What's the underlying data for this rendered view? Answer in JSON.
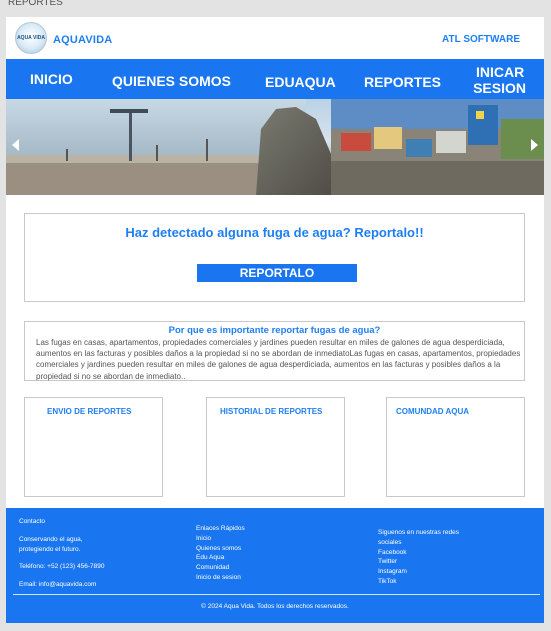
{
  "window": {
    "title": "REPORTES"
  },
  "header": {
    "logo_text": "AQUA VIDA",
    "brand": "AQUAVIDA",
    "company": "ATL SOFTWARE"
  },
  "nav": {
    "inicio": "INICIO",
    "quienes": "QUIENES SOMOS",
    "eduaqua": "EDUAQUA",
    "reportes": "REPORTES",
    "iniciar_1": "INICAR",
    "iniciar_2": "SESION"
  },
  "report": {
    "heading": "Haz detectado alguna fuga de agua? Reportalo!!",
    "button": "REPORTALO"
  },
  "why": {
    "title": "Por que es importante reportar fugas de agua?",
    "text": "Las fugas en casas, apartamentos, propiedades comerciales y jardines pueden resultar en miles de galones de agua desperdiciada, aumentos en las facturas y posibles daños a la propiedad si no se abordan de inmediatoLas fugas en casas, apartamentos, propiedades comerciales y jardines pueden resultar en miles de galones de agua desperdiciada, aumentos en las facturas y posibles daños a la propiedad si no se abordan de inmediato.."
  },
  "cards": [
    {
      "title": "ENVIO DE REPORTES"
    },
    {
      "title": "HISTORIAL DE REPORTES"
    },
    {
      "title": "COMUNDAD AQUA"
    }
  ],
  "footer": {
    "contact_title": "Contacto",
    "tagline_1": "Conservando el agua,",
    "tagline_2": "protegiendo el futuro.",
    "phone": "Teléfono: +52 (123) 456-7890",
    "email": "Email: info@aquavida.com",
    "quick_links": [
      "Enlaces Rápidos",
      "Inicio",
      "Quienes somos",
      "Edu Aqua",
      "Comunidad",
      "Inicio de sesion"
    ],
    "social": [
      "Siguenos en nuestras redes",
      "sociales",
      "Facebook",
      "Twitter",
      "Instagram",
      "TikTok"
    ],
    "copyright": "© 2024 Aqua Vida. Todos los derechos reservados."
  },
  "colors": {
    "accent": "#1976f0",
    "heading": "#1e7ff2",
    "text": "#555555",
    "border": "#c9c9c9"
  },
  "icons": {
    "prev": "chevron-left-icon",
    "next": "chevron-right-icon"
  }
}
